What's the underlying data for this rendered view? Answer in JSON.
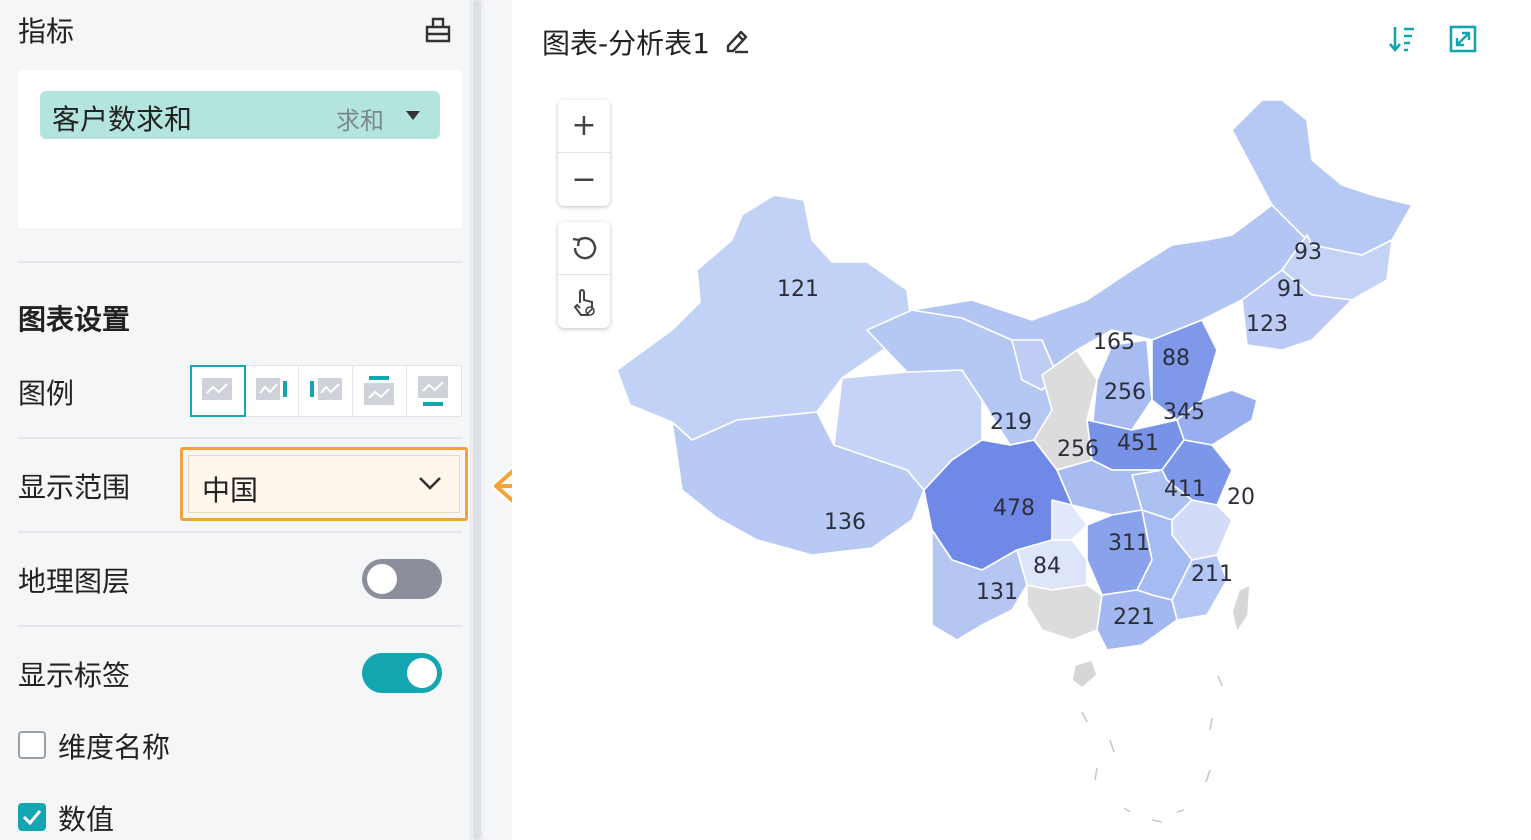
{
  "panel": {
    "metrics_title": "指标",
    "metric_chip": {
      "label": "客户数求和",
      "aggregation": "求和"
    },
    "chart_settings_title": "图表设置",
    "legend_label": "图例",
    "range_label": "显示范围",
    "range_value": "中国",
    "geo_layer_label": "地理图层",
    "geo_layer_on": false,
    "show_labels_label": "显示标签",
    "show_labels_on": true,
    "dimension_name_label": "维度名称",
    "dimension_name_checked": false,
    "value_label": "数值",
    "value_checked": true
  },
  "chart": {
    "title": "图表-分析表1",
    "icons": [
      "edit-icon",
      "sort-icon",
      "expand-icon",
      "zoom-in-icon",
      "zoom-out-icon",
      "reset-icon",
      "select-tool-icon"
    ],
    "colors": {
      "low": "#c9d6f6",
      "mid": "#a9bdf1",
      "high": "#7692e8",
      "none": "#dcdcdc",
      "accent": "#13a5b0",
      "highlight": "#f2a33a"
    }
  },
  "chart_data": {
    "type": "map",
    "region": "中国",
    "value_labels": [
      "121",
      "93",
      "91",
      "123",
      "165",
      "88",
      "256",
      "345",
      "219",
      "256",
      "451",
      "411",
      "20",
      "478",
      "136",
      "311",
      "84",
      "211",
      "131",
      "221"
    ]
  }
}
